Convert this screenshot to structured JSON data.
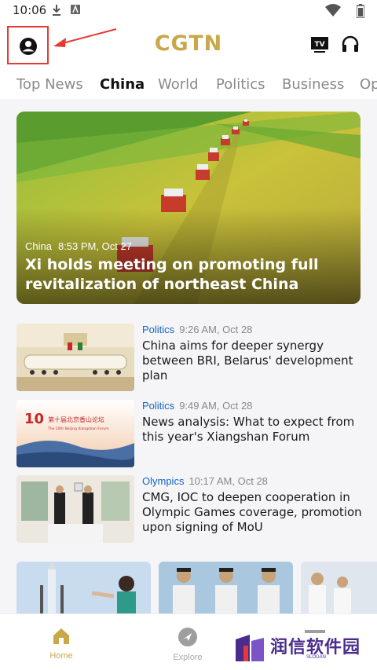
{
  "status_bar": {
    "time": "10:06",
    "icons": [
      "download-icon",
      "notification-a-icon",
      "wifi-icon",
      "battery-icon"
    ]
  },
  "header": {
    "brand": "CGTN",
    "avatar_icon": "account-circle-icon",
    "tv_icon_label": "TV",
    "headphones_icon": "headphones-icon",
    "accent_color": "#c9a84a",
    "highlight_color": "#e53935"
  },
  "tabs": [
    {
      "label": "Top News",
      "active": false
    },
    {
      "label": "China",
      "active": true
    },
    {
      "label": "World",
      "active": false
    },
    {
      "label": "Politics",
      "active": false
    },
    {
      "label": "Business",
      "active": false
    },
    {
      "label": "Op",
      "active": false
    }
  ],
  "hero": {
    "category": "China",
    "time": "8:53 PM, Oct 27",
    "title": "Xi holds meeting on promoting full revitalization of northeast China"
  },
  "news": [
    {
      "category": "Politics",
      "time": "9:26 AM, Oct 28",
      "title": "China aims for deeper synergy between BRI, Belarus' development plan"
    },
    {
      "category": "Politics",
      "time": "9:49 AM, Oct 28",
      "title": "News analysis: What to expect from this year's Xiangshan Forum"
    },
    {
      "category": "Olympics",
      "time": "10:17 AM, Oct 28",
      "title": "CMG, IOC to deepen cooperation in Olympic Games coverage, promotion upon signing of MoU"
    }
  ],
  "thumb_texts": {
    "forum_cn": "第十届北京香山论坛",
    "forum_en": "The 10th Beijing Xiangshan Forum",
    "forum_number": "10"
  },
  "bottom_nav": [
    {
      "label": "Home",
      "icon": "home-icon",
      "active": true
    },
    {
      "label": "Explore",
      "icon": "compass-icon",
      "active": false
    }
  ],
  "watermark": {
    "text": "润信软件园",
    "slogan": "SLOGAN"
  }
}
